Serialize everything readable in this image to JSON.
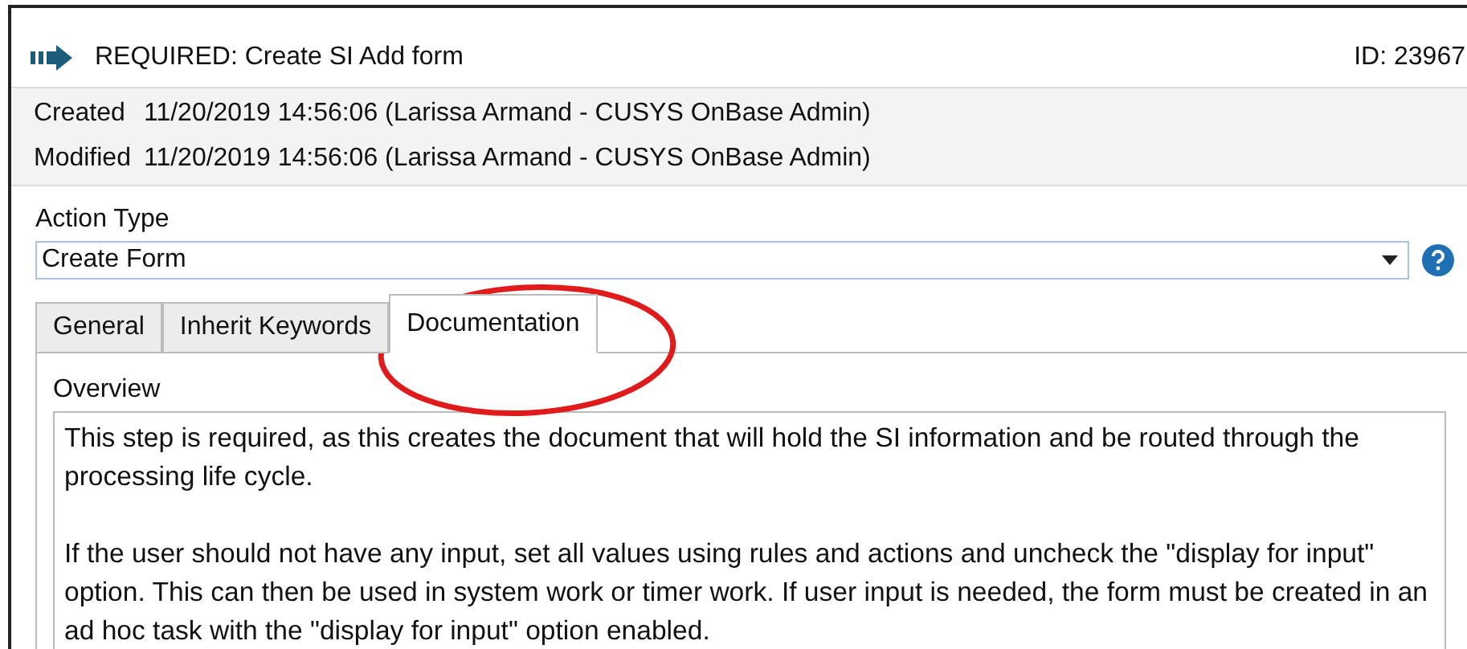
{
  "header": {
    "title": "REQUIRED: Create SI Add form",
    "id": "ID: 23967"
  },
  "meta": [
    {
      "label": "Created",
      "value": "11/20/2019 14:56:06 (Larissa Armand - CUSYS OnBase Admin)"
    },
    {
      "label": "Modified",
      "value": "11/20/2019 14:56:06 (Larissa Armand - CUSYS OnBase Admin)"
    }
  ],
  "action_type": {
    "label": "Action Type",
    "value": "Create Form"
  },
  "tabs": [
    {
      "label": "General",
      "selected": false
    },
    {
      "label": "Inherit Keywords",
      "selected": false
    },
    {
      "label": "Documentation",
      "selected": true
    }
  ],
  "overview": {
    "label": "Overview",
    "paragraphs": [
      "This step is required, as this creates the document that will hold the SI information and be routed through the processing life cycle.",
      "If the user should not have any input, set all values using rules and actions and uncheck the \"display for input\" option. This can then be used in system work or timer work. If user input is needed, the form must be created in an ad hoc task with the \"display for input\" option enabled."
    ]
  }
}
